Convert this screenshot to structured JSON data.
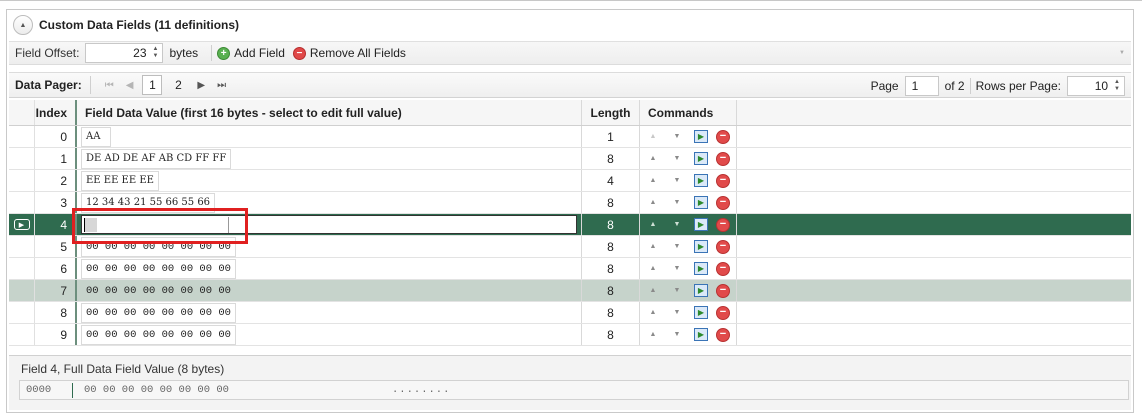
{
  "header": {
    "title": "Custom Data Fields (11 definitions)",
    "collapse_icon": "▲"
  },
  "toolbar": {
    "offset_label": "Field Offset:",
    "offset_value": "23",
    "offset_unit": "bytes",
    "add_label": "Add Field",
    "remove_label": "Remove All Fields"
  },
  "pager": {
    "label": "Data Pager:",
    "pages": [
      "1",
      "2"
    ],
    "page_label": "Page",
    "page_value": "1",
    "page_of": "of 2",
    "rows_label": "Rows per Page:",
    "rows_value": "10"
  },
  "grid": {
    "columns": {
      "index": "Index",
      "value": "Field Data Value (first 16 bytes - select to edit full value)",
      "length": "Length",
      "commands": "Commands"
    },
    "rows": [
      {
        "index": "0",
        "value": "AA",
        "length": "1"
      },
      {
        "index": "1",
        "value": "DE AD DE AF AB CD FF FF",
        "length": "8"
      },
      {
        "index": "2",
        "value": "EE EE EE EE",
        "length": "4"
      },
      {
        "index": "3",
        "value": "12 34 43 21 55 66 55 66",
        "length": "8"
      },
      {
        "index": "4",
        "value": "",
        "length": "8"
      },
      {
        "index": "5",
        "value": "00 00 00 00 00 00 00 00",
        "length": "8"
      },
      {
        "index": "6",
        "value": "00 00 00 00 00 00 00 00",
        "length": "8"
      },
      {
        "index": "7",
        "value": "00 00 00 00 00 00 00 00",
        "length": "8"
      },
      {
        "index": "8",
        "value": "00 00 00 00 00 00 00 00",
        "length": "8"
      },
      {
        "index": "9",
        "value": "00 00 00 00 00 00 00 00",
        "length": "8"
      }
    ]
  },
  "footer": {
    "title": "Field 4, Full Data Field Value (8 bytes)",
    "offset": "0000",
    "hex": "00 00 00 00 00 00 00 00",
    "ascii": "........"
  },
  "colors": {
    "selected_row": "#2f6b4f",
    "hover_row": "#c6d3cb",
    "highlight": "#e02020"
  }
}
